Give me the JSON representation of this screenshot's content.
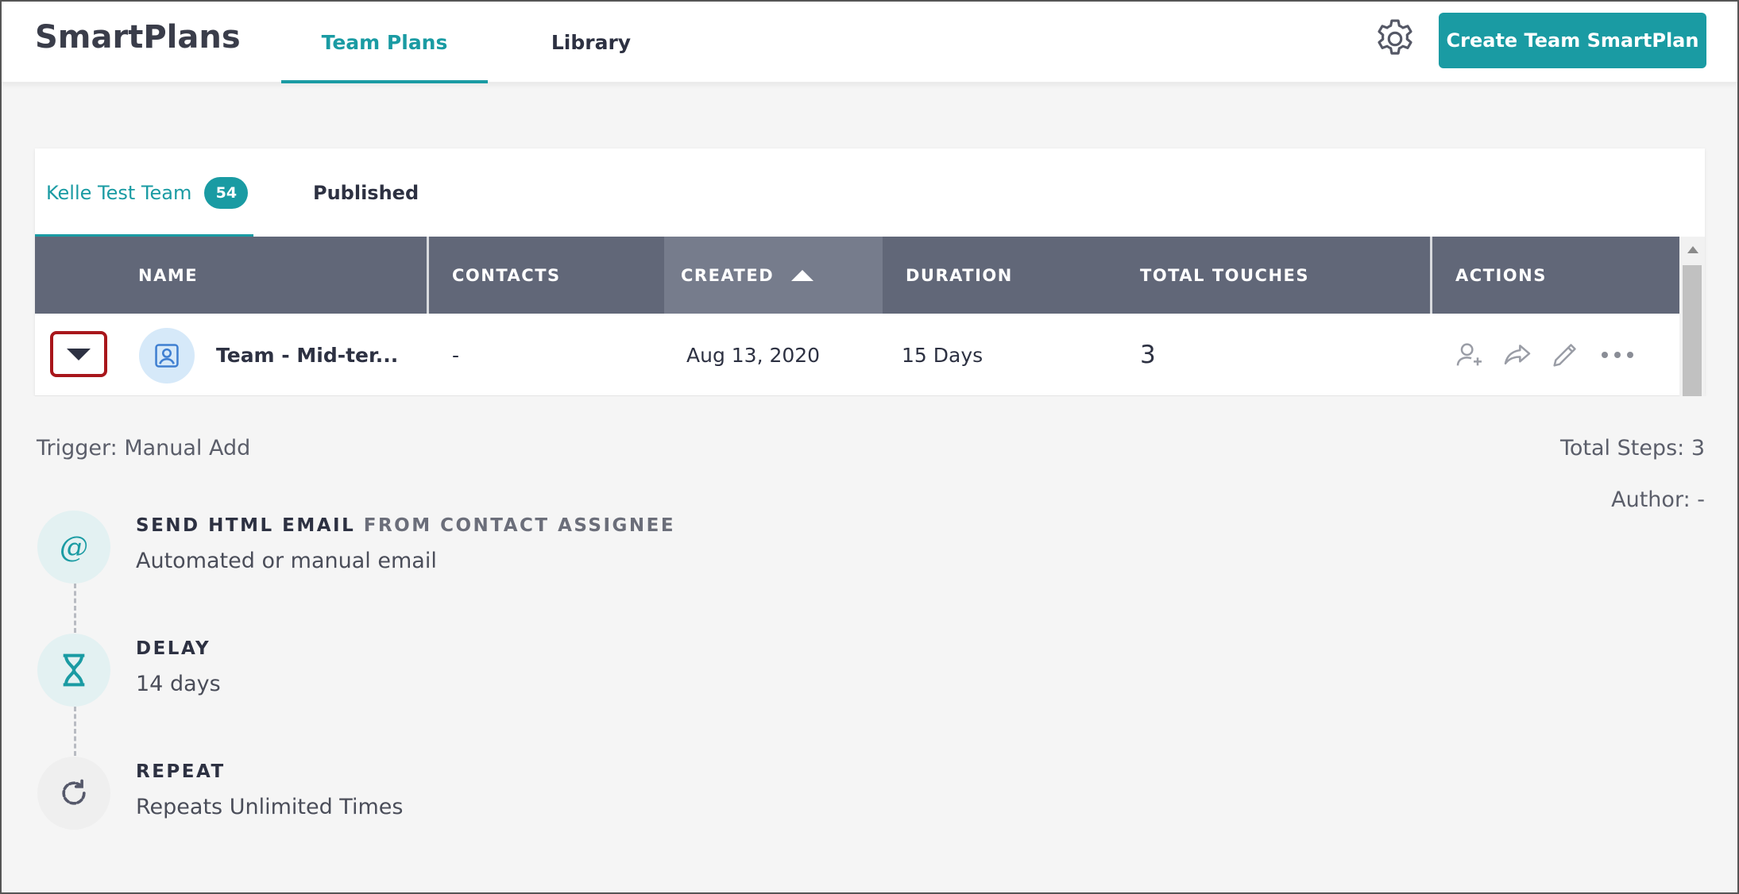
{
  "app": {
    "brand": "SmartPlans",
    "nav_tabs": [
      {
        "label": "Team Plans",
        "active": true
      },
      {
        "label": "Library",
        "active": false
      }
    ],
    "create_button": "Create Team SmartPlan",
    "accent_color": "#1a9ba3"
  },
  "subtabs": {
    "team": {
      "label": "Kelle Test Team",
      "count": "54"
    },
    "published": {
      "label": "Published"
    }
  },
  "table": {
    "columns": [
      "NAME",
      "CONTACTS",
      "CREATED",
      "DURATION",
      "TOTAL TOUCHES",
      "ACTIONS"
    ],
    "sorted_column": "CREATED",
    "sort_direction": "ascending",
    "row": {
      "name": "Team - Mid-ter...",
      "contacts": "-",
      "created": "Aug 13, 2020",
      "duration": "15 Days",
      "total_touches": "3",
      "actions": [
        "add-contact-icon",
        "share-icon",
        "edit-icon",
        "more-icon"
      ]
    }
  },
  "details": {
    "trigger": "Trigger: Manual Add",
    "total_steps": "Total Steps: 3",
    "author": "Author: -",
    "steps": [
      {
        "title": "SEND HTML EMAIL",
        "title_suffix": "FROM CONTACT ASSIGNEE",
        "desc": "Automated or manual email",
        "icon": "at-icon"
      },
      {
        "title": "DELAY",
        "title_suffix": "",
        "desc": "14 days",
        "icon": "hourglass-icon"
      },
      {
        "title": "REPEAT",
        "title_suffix": "",
        "desc": "Repeats Unlimited Times",
        "icon": "repeat-icon"
      }
    ]
  }
}
